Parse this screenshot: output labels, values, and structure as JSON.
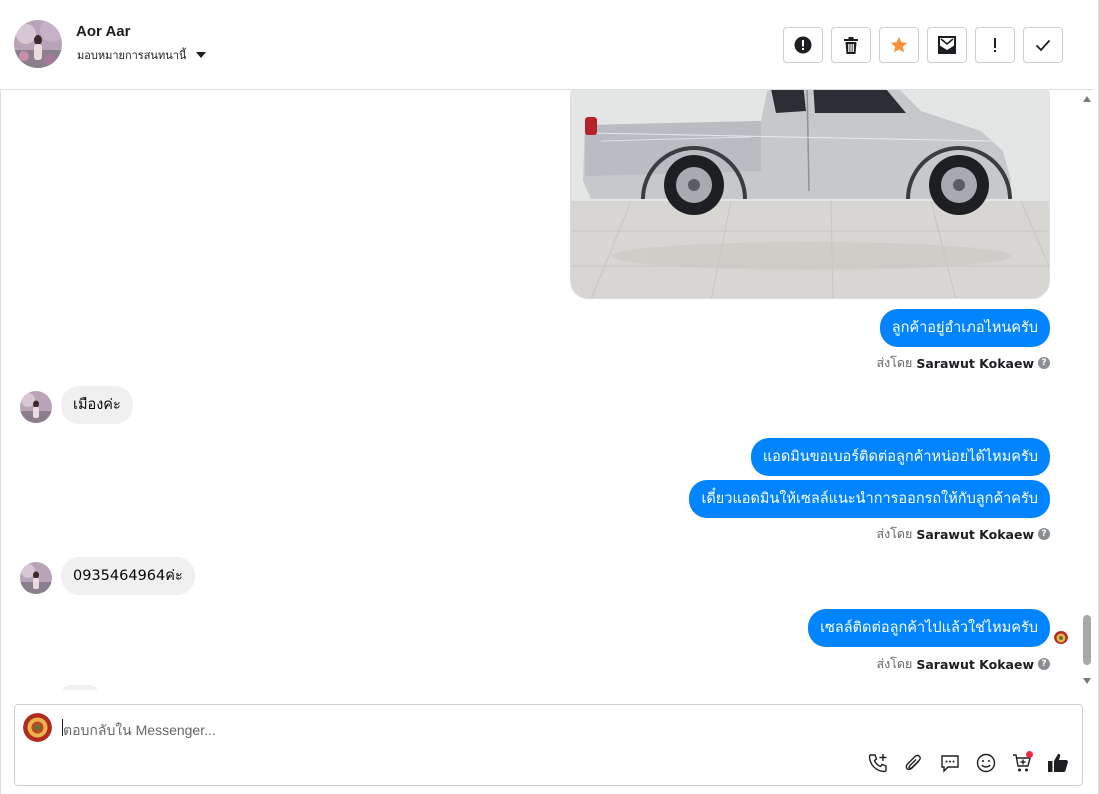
{
  "header": {
    "contact_name": "Aor Aar",
    "assign_label": "มอบหมายการสนทนานี้"
  },
  "toolbar": [
    {
      "name": "report-spam-button",
      "icon": "alert-circle-icon"
    },
    {
      "name": "delete-button",
      "icon": "trash-icon"
    },
    {
      "name": "star-button",
      "icon": "star-icon"
    },
    {
      "name": "mark-unread-button",
      "icon": "envelope-icon"
    },
    {
      "name": "important-button",
      "icon": "exclamation-icon"
    },
    {
      "name": "mark-done-button",
      "icon": "check-icon"
    }
  ],
  "conversation": {
    "msg1": "ลูกค้าอยู่อำเภอไหนครับ",
    "sent_prefix": "ส่งโดย",
    "agent": "Sarawut Kokaew",
    "reply1": "เมืองค่ะ",
    "msg2": "แอดมินขอเบอร์ติดต่อลูกค้าหน่อยได้ไหมครับ",
    "msg3": "เดี๋ยวแอดมินให้เซลล์แนะนำการออกรถให้กับลูกค้าครับ",
    "reply2": "0935464964ค่ะ",
    "msg4": "เซลล์ติดต่อลูกค้าไปแล้วใช่ไหมครับ"
  },
  "composer": {
    "placeholder": "ตอบกลับใน Messenger..."
  },
  "colors": {
    "accent": "#0084ff",
    "incoming_bubble": "#f0f0f0",
    "star": "#f7923a"
  }
}
